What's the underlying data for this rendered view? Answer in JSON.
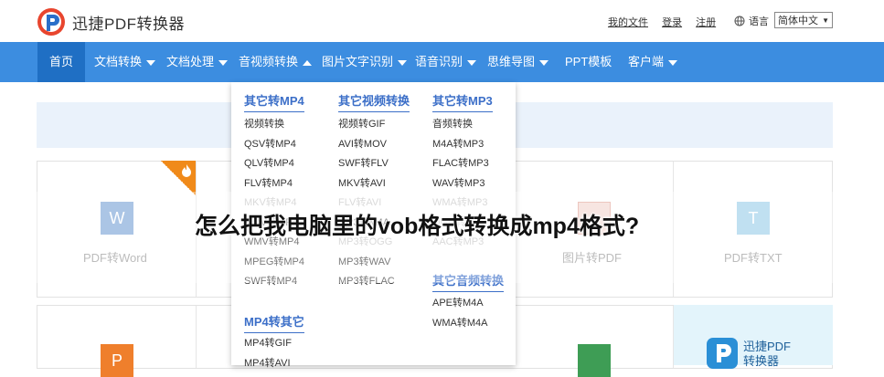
{
  "header": {
    "brand": "迅捷PDF转换器",
    "links": [
      "我的文件",
      "登录",
      "注册"
    ],
    "lang_label": "语言",
    "lang_value": "简体中文"
  },
  "nav": {
    "items": [
      "首页",
      "文档转换",
      "文档处理",
      "音视频转换",
      "图片文字识别",
      "语音识别",
      "思维导图",
      "PPT模板",
      "客户端"
    ]
  },
  "dropdown": {
    "col1_head": "其它转MP4",
    "col1_items": [
      "视频转换",
      "QSV转MP4",
      "QLV转MP4",
      "FLV转MP4",
      "MKV转MP4",
      "MOV转MP4",
      "WMV转MP4",
      "MPEG转MP4",
      "SWF转MP4"
    ],
    "col1_head2": "MP4转其它",
    "col1_items2": [
      "MP4转GIF",
      "MP4转AVI"
    ],
    "col2_head": "其它视频转换",
    "col2_items": [
      "视频转GIF",
      "AVI转MOV",
      "SWF转FLV",
      "MKV转AVI",
      "FLV转AVI",
      "MP3转M4A",
      "MP3转OGG",
      "MP3转WAV",
      "MP3转FLAC"
    ],
    "col3_head": "其它转MP3",
    "col3_items": [
      "音频转换",
      "M4A转MP3",
      "FLAC转MP3",
      "WAV转MP3",
      "WMA转MP3",
      "OGG转MP3",
      "AAC转MP3"
    ],
    "col3_head2": "其它音频转换",
    "col3_items2": [
      "APE转M4A",
      "WMA转M4A"
    ]
  },
  "cards": {
    "word_label": "PDF转Word",
    "img_label": "图片转PDF",
    "txt_label": "PDF转TXT",
    "word_icon": "W",
    "txt_icon": "T",
    "ppt_icon": "P",
    "promo_brand": "迅捷PDF",
    "promo_sub": "转换器"
  },
  "overlay": {
    "title": "怎么把我电脑里的vob格式转换成mp4格式?"
  },
  "colors": {
    "nav_bg": "#3c8de0",
    "nav_active": "#1f6fc4",
    "heading_blue": "#3c6fc8",
    "hot_orange": "#f08a1a"
  }
}
